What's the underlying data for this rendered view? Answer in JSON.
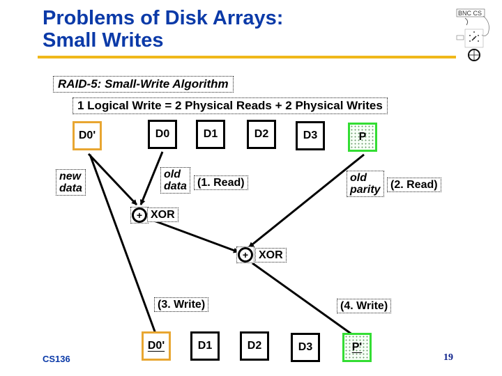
{
  "slide": {
    "title_line1": "Problems of Disk Arrays:",
    "title_line2": "Small Writes",
    "footer_course": "CS136",
    "page_number": "19",
    "colors": {
      "title": "#0b3aa8",
      "rule": "#f0b81a",
      "new_data_border": "#e8a631",
      "parity_border": "#33dd33"
    }
  },
  "diagram": {
    "heading": "RAID-5: Small-Write Algorithm",
    "equation": "1 Logical Write = 2 Physical Reads + 2  Physical Writes",
    "new_block": "D0'",
    "top_row": [
      "D0",
      "D1",
      "D2",
      "D3",
      "P"
    ],
    "bottom_row": [
      "D0'",
      "D1",
      "D2",
      "D3",
      "P'"
    ],
    "labels": {
      "new_data": "new data",
      "new_data_l1": "new",
      "new_data_l2": "data",
      "old_data_l1": "old",
      "old_data_l2": "data",
      "read1": "(1. Read)",
      "old_parity_l1": "old",
      "old_parity_l2": "parity",
      "read2": "(2. Read)",
      "xor1": "XOR",
      "xor2": "XOR",
      "xor_symbol": "+",
      "write3": "(3. Write)",
      "write4": "(4. Write)"
    }
  }
}
